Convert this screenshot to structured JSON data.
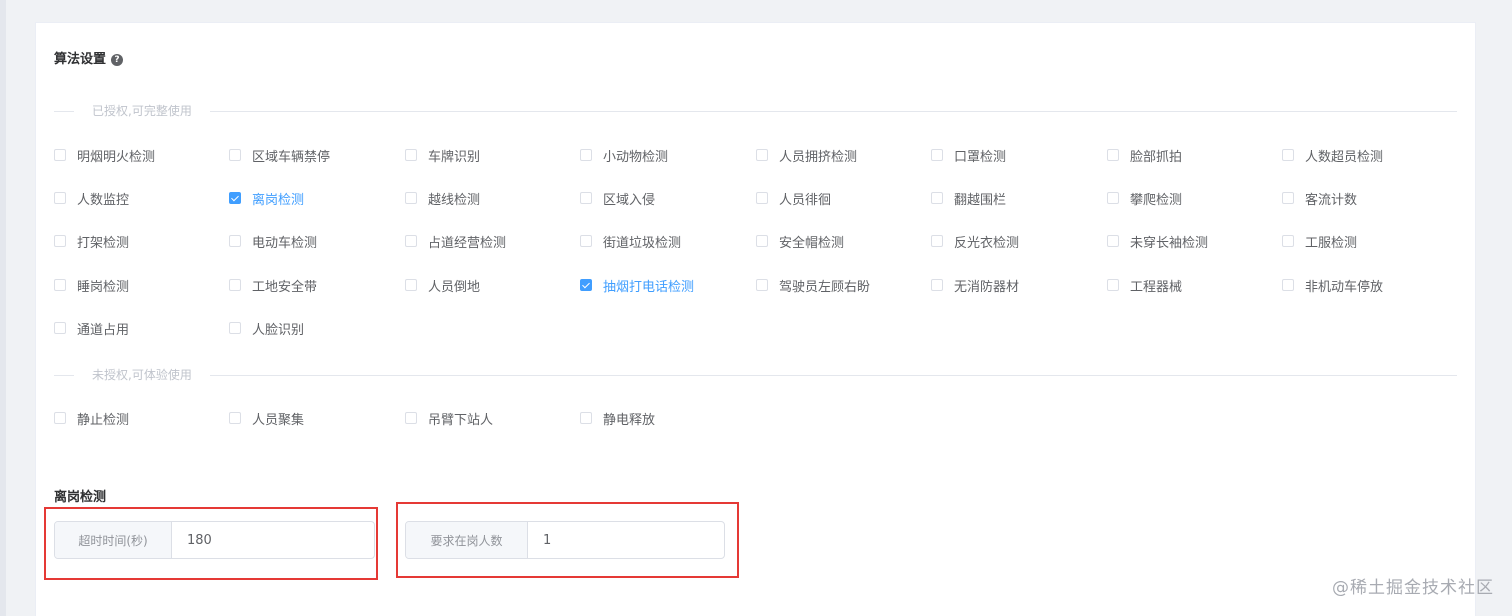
{
  "settings": {
    "title": "算法设置",
    "help_icon": "question-circle-icon",
    "authorized_label": "已授权,可完整使用",
    "unauthorized_label": "未授权,可体验使用",
    "authorized_options": [
      {
        "label": "明烟明火检测",
        "checked": false
      },
      {
        "label": "区域车辆禁停",
        "checked": false
      },
      {
        "label": "车牌识别",
        "checked": false
      },
      {
        "label": "小动物检测",
        "checked": false
      },
      {
        "label": "人员拥挤检测",
        "checked": false
      },
      {
        "label": "口罩检测",
        "checked": false
      },
      {
        "label": "脸部抓拍",
        "checked": false
      },
      {
        "label": "人数超员检测",
        "checked": false
      },
      {
        "label": "人数监控",
        "checked": false
      },
      {
        "label": "离岗检测",
        "checked": true
      },
      {
        "label": "越线检测",
        "checked": false
      },
      {
        "label": "区域入侵",
        "checked": false
      },
      {
        "label": "人员徘徊",
        "checked": false
      },
      {
        "label": "翻越围栏",
        "checked": false
      },
      {
        "label": "攀爬检测",
        "checked": false
      },
      {
        "label": "客流计数",
        "checked": false
      },
      {
        "label": "打架检测",
        "checked": false
      },
      {
        "label": "电动车检测",
        "checked": false
      },
      {
        "label": "占道经营检测",
        "checked": false
      },
      {
        "label": "街道垃圾检测",
        "checked": false
      },
      {
        "label": "安全帽检测",
        "checked": false
      },
      {
        "label": "反光衣检测",
        "checked": false
      },
      {
        "label": "未穿长袖检测",
        "checked": false
      },
      {
        "label": "工服检测",
        "checked": false
      },
      {
        "label": "睡岗检测",
        "checked": false
      },
      {
        "label": "工地安全带",
        "checked": false
      },
      {
        "label": "人员倒地",
        "checked": false
      },
      {
        "label": "抽烟打电话检测",
        "checked": true
      },
      {
        "label": "驾驶员左顾右盼",
        "checked": false
      },
      {
        "label": "无消防器材",
        "checked": false
      },
      {
        "label": "工程器械",
        "checked": false
      },
      {
        "label": "非机动车停放",
        "checked": false
      },
      {
        "label": "通道占用",
        "checked": false
      },
      {
        "label": "人脸识别",
        "checked": false
      }
    ],
    "unauthorized_options": [
      {
        "label": "静止检测",
        "checked": false
      },
      {
        "label": "人员聚集",
        "checked": false
      },
      {
        "label": "吊臂下站人",
        "checked": false
      },
      {
        "label": "静电释放",
        "checked": false
      }
    ]
  },
  "detail": {
    "title": "离岗检测",
    "timeout_label": "超时时间(秒)",
    "timeout_value": "180",
    "required_label": "要求在岗人数",
    "required_value": "1"
  },
  "watermark": "@稀土掘金技术社区"
}
